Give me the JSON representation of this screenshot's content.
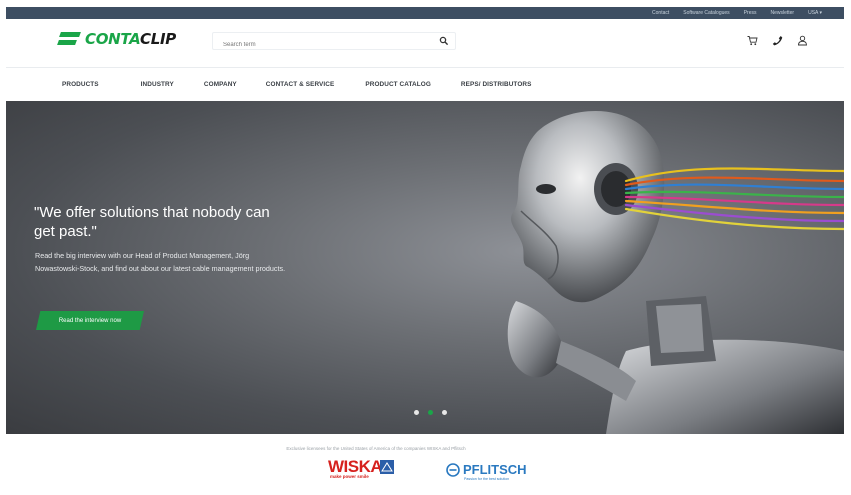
{
  "topbar": {
    "links": [
      "Contact",
      "Software Catalogues",
      "Press",
      "Newsletter",
      "USA ▾"
    ]
  },
  "header": {
    "logo_part1": "CONTA",
    "logo_part2": "CLIP",
    "search_placeholder": "Search term",
    "icons": [
      "cart-icon",
      "phone-icon",
      "user-icon"
    ]
  },
  "nav": {
    "items": [
      "PRODUCTS",
      "INDUSTRY",
      "COMPANY",
      "CONTACT & SERVICE",
      "PRODUCT CATALOG",
      "REPS/ DISTRIBUTORS"
    ]
  },
  "hero": {
    "title": "\"We offer solutions that nobody can get past.\"",
    "body": "Read the big interview with our Head of Product Management, Jörg Nowastowski-Stock, and find out about our latest cable management products.",
    "button": "Read the interview now",
    "slides_total": 3,
    "active_slide": 2
  },
  "partners": {
    "text": "Exclusive licensees for the United States of America of the companies WISKA and Pflitsch",
    "wiska_word": "WISKA",
    "wiska_tagline": "make power smile",
    "pflitsch_word": "PFLITSCH",
    "pflitsch_tagline": "Passion for the best solution"
  },
  "colors": {
    "brand_green": "#1aa548",
    "topbar": "#3d4e62",
    "wiska_red": "#d6211e",
    "pflitsch_blue": "#2a79c0"
  }
}
